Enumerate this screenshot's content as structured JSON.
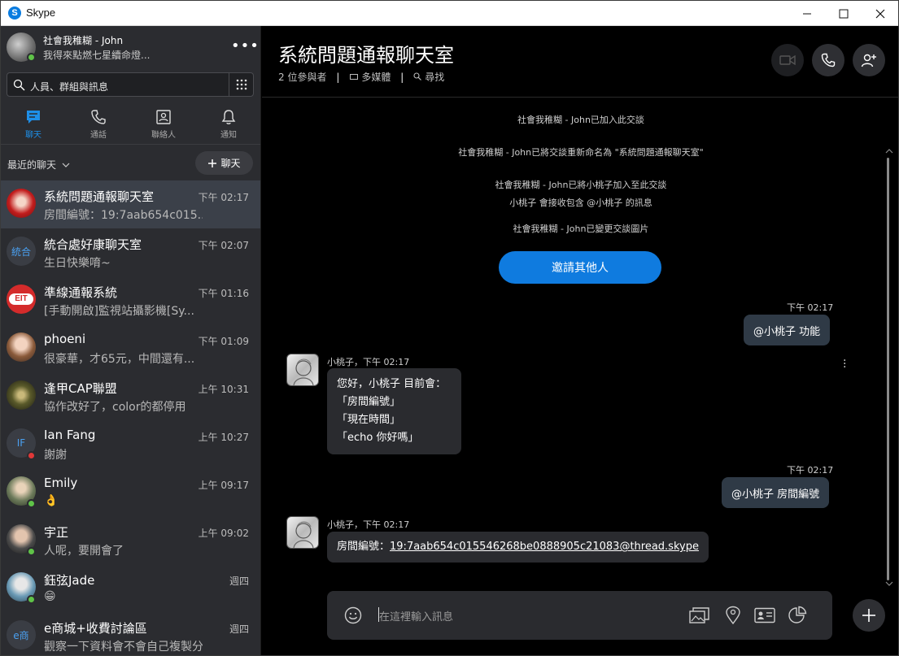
{
  "window": {
    "title": "Skype"
  },
  "profile": {
    "name": "社會我稚糊 - John",
    "mood": "我得來點燃七星續命燈..."
  },
  "search": {
    "placeholder": "人員、群組與訊息"
  },
  "nav": {
    "tabs": [
      {
        "label": "聊天",
        "icon": "chat-icon",
        "active": true
      },
      {
        "label": "通話",
        "icon": "phone-icon",
        "active": false
      },
      {
        "label": "聯絡人",
        "icon": "contacts-icon",
        "active": false
      },
      {
        "label": "通知",
        "icon": "bell-icon",
        "active": false
      }
    ]
  },
  "recent": {
    "label": "最近的聊天",
    "new_chat": "聊天"
  },
  "chats": [
    {
      "name": "系統問題通報聊天室",
      "time": "下午 02:17",
      "preview": "房間編號：19:7aab654c015...",
      "selected": true
    },
    {
      "name": "統合處好康聊天室",
      "time": "下午 02:07",
      "preview": "生日快樂唷~",
      "avatar_text": "統合"
    },
    {
      "name": "準線通報系統",
      "time": "下午 01:16",
      "preview": "[手動開啟]監視站攝影機[Sy..."
    },
    {
      "name": "phoeni",
      "time": "下午 01:09",
      "preview": "很豪華，才65元，中間還有..."
    },
    {
      "name": "逢甲CAP聯盟",
      "time": "上午 10:31",
      "preview": "協作改好了，color的都停用"
    },
    {
      "name": "Ian Fang",
      "time": "上午 10:27",
      "preview": "謝謝",
      "avatar_text": "IF"
    },
    {
      "name": "Emily",
      "time": "上午 09:17",
      "preview": "👌"
    },
    {
      "name": "宇正",
      "time": "上午 09:02",
      "preview": "人呢，要開會了"
    },
    {
      "name": "鈺弦Jade",
      "time": "週四",
      "preview": "😁"
    },
    {
      "name": "e商城+收費討論區",
      "time": "週四",
      "preview": "觀察一下資料會不會自己複製分...",
      "avatar_text": "e商"
    }
  ],
  "conversation": {
    "title": "系統問題通報聊天室",
    "participants": "2 位參與者",
    "media": "多媒體",
    "find": "尋找",
    "system_messages": [
      "社會我稚糊 - John已加入此交談",
      "社會我稚糊 - John已將交談重新命名為 \"系統問題通報聊天室\"",
      "社會我稚糊 - John已將小桃子加入至此交談",
      "小桃子 會接收包含 @小桃子 的訊息",
      "社會我稚糊 - John已變更交談圖片"
    ],
    "invite_button": "邀請其他人",
    "messages": [
      {
        "direction": "out",
        "time": "下午 02:17",
        "text": "@小桃子 功能"
      },
      {
        "direction": "in",
        "sender": "小桃子，下午 02:17",
        "lines": [
          "您好，小桃子 目前會：",
          "「房間編號」",
          "「現在時間」",
          "「echo 你好嗎」"
        ]
      },
      {
        "direction": "out",
        "time": "下午 02:17",
        "text": "@小桃子 房間編號"
      },
      {
        "direction": "in",
        "sender": "小桃子，下午 02:17",
        "prefix": "房間編號：",
        "link": "19:7aab654c015546268be0888905c21083@thread.skype"
      }
    ]
  },
  "composer": {
    "placeholder": "在這裡輸入訊息"
  },
  "colors": {
    "accent": "#0f7bdf",
    "sidebar_bg": "#2b2c30",
    "main_bg": "#000000",
    "presence_online": "#5fc348"
  }
}
